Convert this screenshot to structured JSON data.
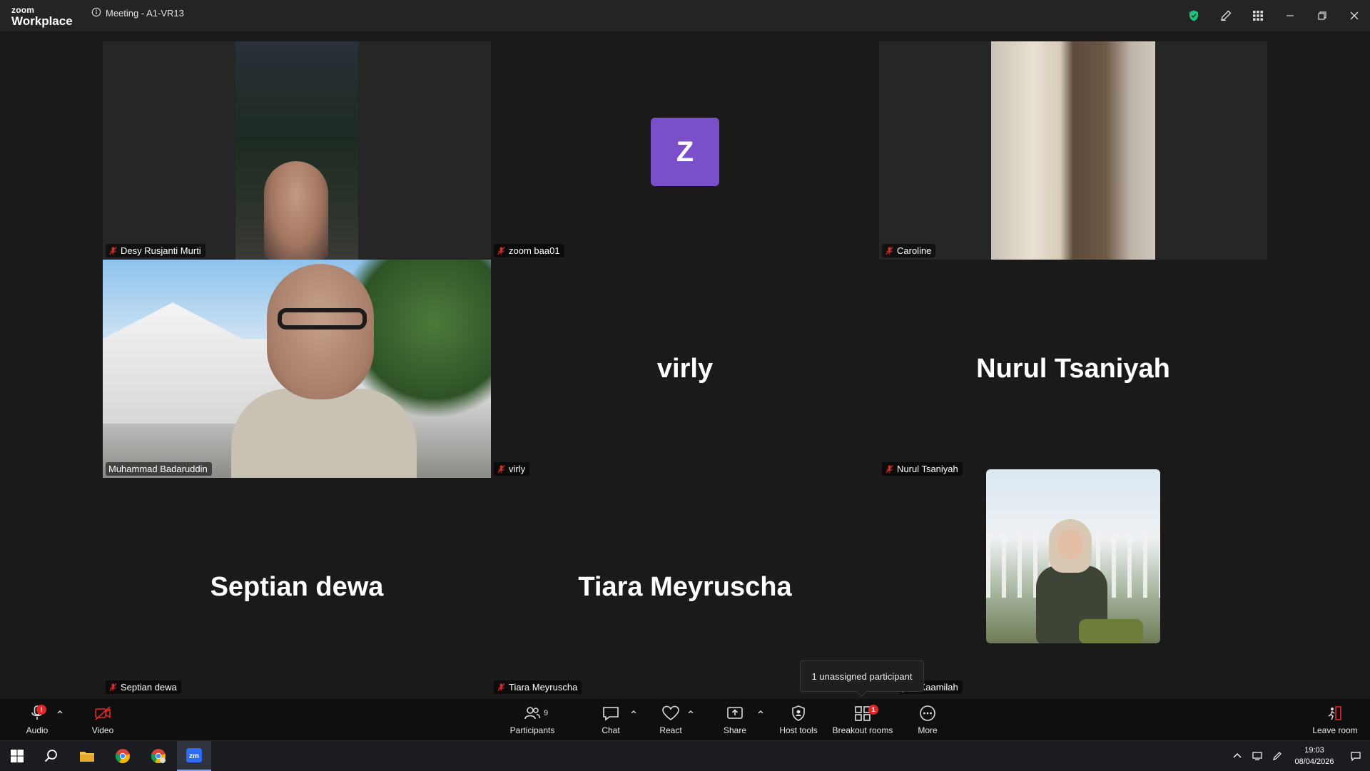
{
  "window": {
    "brand_line1": "zoom",
    "brand_line2": "Workplace",
    "meeting_title": "Meeting - A1-VR13"
  },
  "participants": {
    "desy": "Desy Rusjanti Murti",
    "zoom_baa01": "zoom baa01",
    "zoom_avatar_letter": "Z",
    "caroline": "Caroline",
    "muhammad": "Muhammad Badaruddin",
    "virly_big": "virly",
    "virly": "virly",
    "nurul_big": "Nurul Tsaniyah",
    "nurul": "Nurul Tsaniyah",
    "septian_big": "Septian dewa",
    "septian": "Septian dewa",
    "tiara_big": "Tiara Meyruscha",
    "tiara": "Tiara Meyruscha",
    "kaamilah_partial": "yah Kaamilah"
  },
  "tooltip": "1 unassigned participant",
  "toolbar": {
    "audio": "Audio",
    "video": "Video",
    "participants": "Participants",
    "participants_count": "9",
    "chat": "Chat",
    "react": "React",
    "share": "Share",
    "host_tools": "Host tools",
    "breakout_rooms": "Breakout rooms",
    "breakout_badge": "1",
    "more": "More",
    "leave_room": "Leave room"
  },
  "taskbar": {
    "time": "19:03",
    "date": "08/04/2026",
    "zoom_app_label": "zm"
  },
  "colors": {
    "active_speaker_border": "#2ecc71",
    "avatar_bg": "#7b4fc9",
    "mute_red": "#e02828",
    "shield_green": "#1ec27a"
  }
}
